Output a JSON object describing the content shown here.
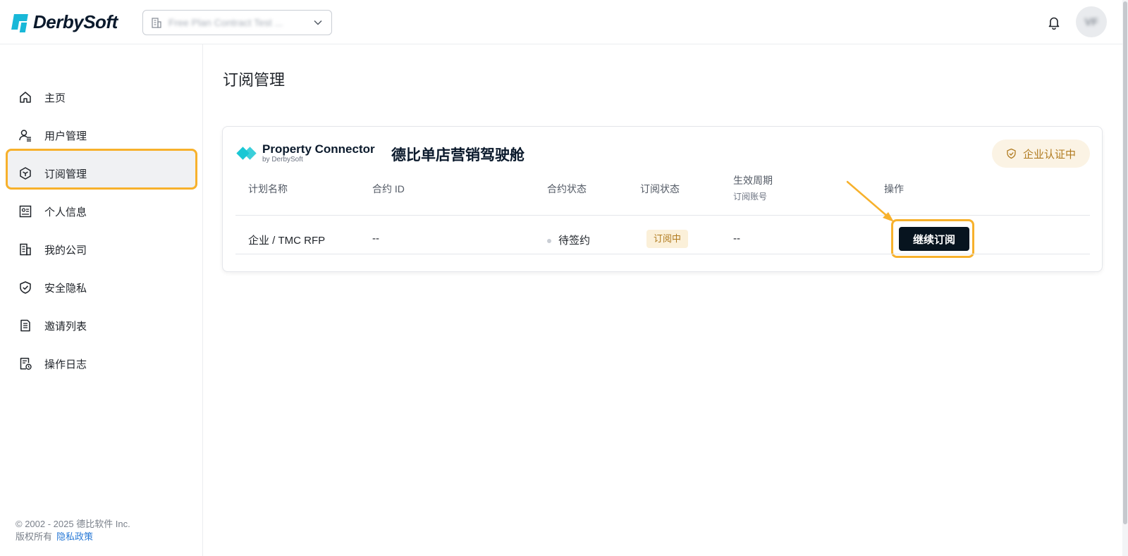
{
  "header": {
    "logo_text": "DerbySoft",
    "org_selector_value": "Free Plan Contract Test ...",
    "avatar_initials": "VF"
  },
  "sidebar": {
    "items": [
      {
        "label": "主页",
        "icon": "home-icon"
      },
      {
        "label": "用户管理",
        "icon": "user-manage-icon"
      },
      {
        "label": "订阅管理",
        "icon": "cube-icon",
        "active": true
      },
      {
        "label": "个人信息",
        "icon": "profile-card-icon"
      },
      {
        "label": "我的公司",
        "icon": "building-icon"
      },
      {
        "label": "安全隐私",
        "icon": "shield-icon"
      },
      {
        "label": "邀请列表",
        "icon": "list-doc-icon"
      },
      {
        "label": "操作日志",
        "icon": "log-clock-icon"
      }
    ],
    "footer": {
      "copyright": "© 2002 - 2025 德比软件 Inc.",
      "rights": "版权所有",
      "privacy_link": "隐私政策"
    }
  },
  "main": {
    "page_title": "订阅管理",
    "card": {
      "brand_name": "Property Connector",
      "brand_by": "by DerbySoft",
      "product_name": "德比单店营销驾驶舱",
      "cert_badge": "企业认证中",
      "columns": {
        "plan_name": "计划名称",
        "contract_id": "合约 ID",
        "contract_status": "合约状态",
        "subscription_status": "订阅状态",
        "period": "生效周期",
        "period_sub": "订阅账号",
        "action": "操作"
      },
      "row": {
        "plan_name": "企业 / TMC RFP",
        "contract_id": "--",
        "contract_status": "待签约",
        "subscription_status": "订阅中",
        "period": "--",
        "action_label": "继续订阅"
      }
    }
  },
  "colors": {
    "highlight": "#f7b12c",
    "brand_cyan": "#18b8d8",
    "button_bg": "#07141f",
    "tag_bg": "#fbf0d9",
    "tag_text": "#b07a1e"
  }
}
